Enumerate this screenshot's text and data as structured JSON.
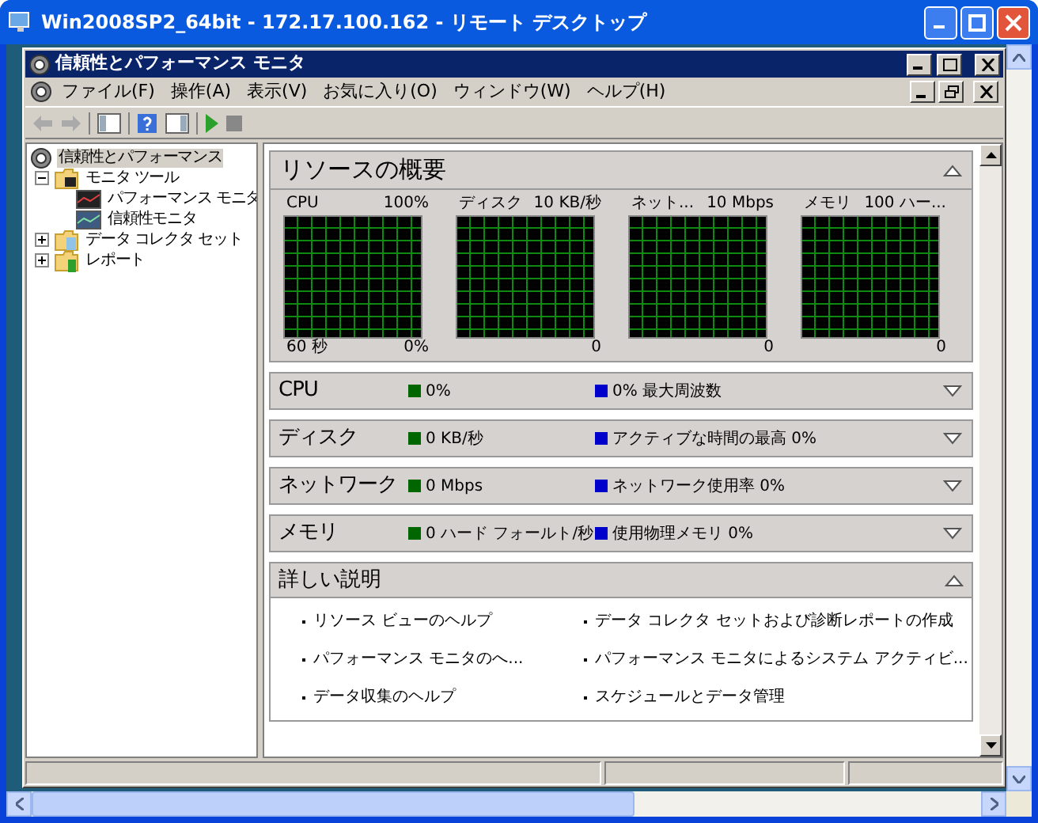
{
  "window": {
    "title": "Win2008SP2_64bit - 172.17.100.162 - リモート デスクトップ"
  },
  "console": {
    "title": "信頼性とパフォーマンス モニタ",
    "menu": [
      "ファイル(F)",
      "操作(A)",
      "表示(V)",
      "お気に入り(O)",
      "ウィンドウ(W)",
      "ヘルプ(H)"
    ]
  },
  "tree": [
    {
      "label": "信頼性とパフォーマンス",
      "selected": true,
      "children": [
        {
          "label": "モニタ ツール",
          "selected": false,
          "expanded": true,
          "children": [
            {
              "label": "パフォーマンス モニタ",
              "selected": false
            },
            {
              "label": "信頼性モニタ",
              "selected": false
            }
          ]
        },
        {
          "label": "データ コレクタ セット",
          "selected": false,
          "expanded": false
        },
        {
          "label": "レポート",
          "selected": false,
          "expanded": false
        }
      ]
    }
  ],
  "overview": {
    "title": "リソースの概要",
    "expanded": true,
    "graphs": [
      {
        "label": "CPU",
        "max": "100%",
        "time": "60 秒",
        "min": "0%"
      },
      {
        "label": "ディスク",
        "max": "10 KB/秒",
        "min": "0"
      },
      {
        "label": "ネット...",
        "max": "10 Mbps",
        "min": "0"
      },
      {
        "label": "メモリ",
        "max": "100 ハー...",
        "min": "0"
      }
    ]
  },
  "sections": [
    {
      "title": "CPU",
      "expanded": false,
      "legend": [
        {
          "text": "0%",
          "color": "#006600"
        },
        {
          "text": "0% 最大周波数",
          "color": "#0000cc"
        }
      ]
    },
    {
      "title": "ディスク",
      "expanded": false,
      "legend": [
        {
          "text": "0 KB/秒",
          "color": "#006600"
        },
        {
          "text": "アクティブな時間の最高 0%",
          "color": "#0000cc"
        }
      ]
    },
    {
      "title": "ネットワーク",
      "expanded": false,
      "legend": [
        {
          "text": "0 Mbps",
          "color": "#006600"
        },
        {
          "text": "ネットワーク使用率 0%",
          "color": "#0000cc"
        }
      ]
    },
    {
      "title": "メモリ",
      "expanded": false,
      "legend": [
        {
          "text": "0 ハード フォールト/秒",
          "color": "#006600"
        },
        {
          "text": "使用物理メモリ 0%",
          "color": "#0000cc"
        }
      ]
    }
  ],
  "details": {
    "title": "詳しい説明",
    "expanded": true,
    "links": [
      "リソース ビューのヘルプ",
      "データ コレクタ セットおよび診断レポートの作成",
      "パフォーマンス モニタのへ...",
      "パフォーマンス モニタによるシステム アクティビ...",
      "データ収集のヘルプ",
      "スケジュールとデータ管理"
    ]
  }
}
